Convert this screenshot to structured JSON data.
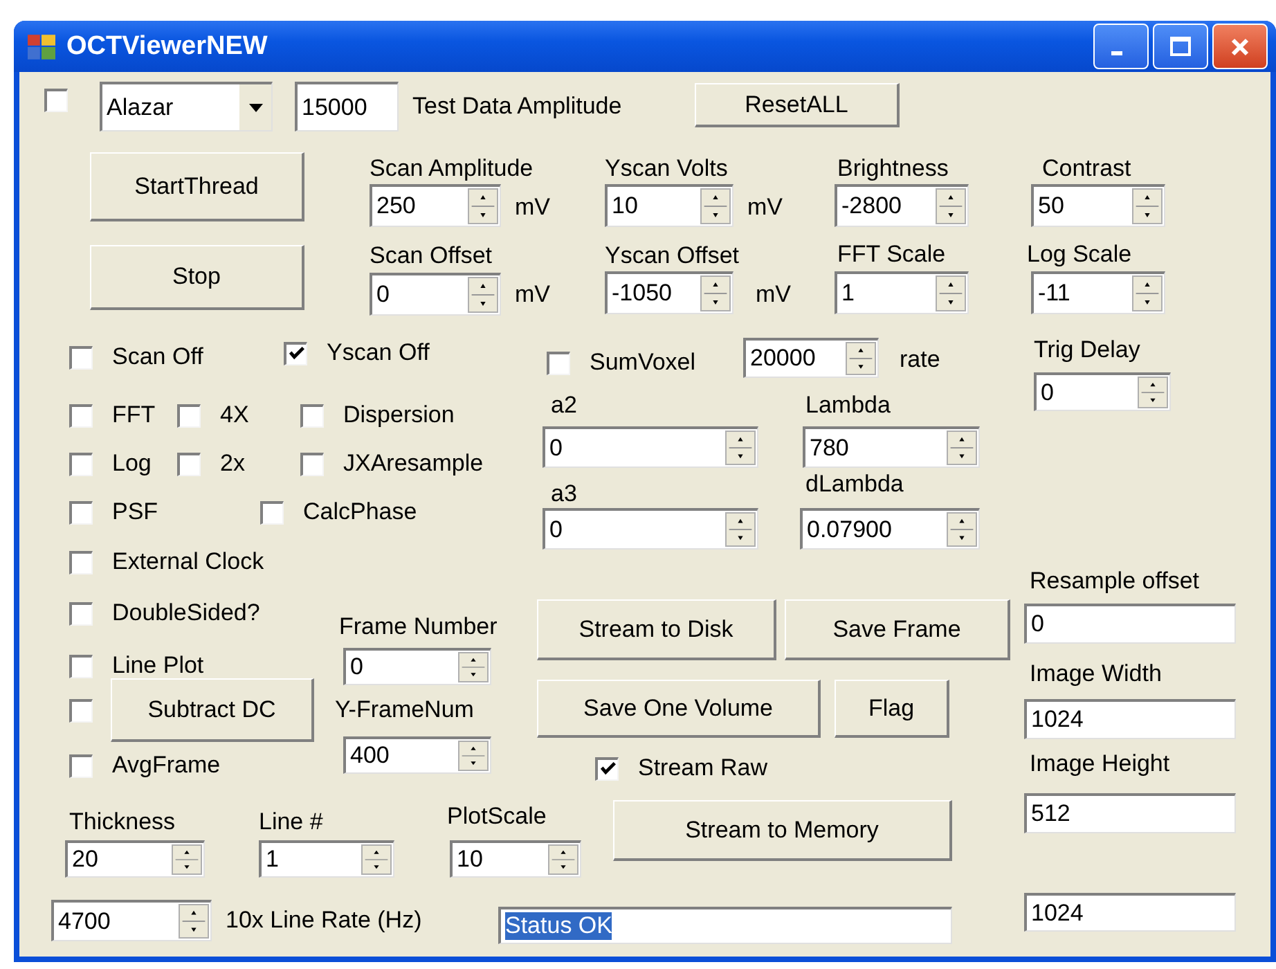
{
  "window": {
    "title": "OCTViewerNEW"
  },
  "controls": [
    {
      "kind": "checkbox",
      "checked": false
    },
    {
      "kind": "combo",
      "value": "Alazar"
    },
    {
      "kind": "textbox",
      "value": "15000"
    },
    {
      "kind": "label",
      "text": "Test Data Amplitude"
    },
    {
      "kind": "button",
      "label": "ResetALL"
    },
    {
      "kind": "button",
      "label": "StartThread"
    },
    {
      "kind": "button",
      "label": "Stop"
    },
    {
      "kind": "label",
      "text": "Scan Amplitude"
    },
    {
      "kind": "spin",
      "value": "250"
    },
    {
      "kind": "label",
      "text": "mV"
    },
    {
      "kind": "label",
      "text": "Yscan Volts"
    },
    {
      "kind": "spin",
      "value": "10"
    },
    {
      "kind": "label",
      "text": "mV"
    },
    {
      "kind": "label",
      "text": "Brightness"
    },
    {
      "kind": "spin",
      "value": "-2800"
    },
    {
      "kind": "label",
      "text": "Contrast"
    },
    {
      "kind": "spin",
      "value": "50"
    },
    {
      "kind": "label",
      "text": "Scan Offset"
    },
    {
      "kind": "spin",
      "value": "0"
    },
    {
      "kind": "label",
      "text": "mV"
    },
    {
      "kind": "label",
      "text": "Yscan Offset"
    },
    {
      "kind": "spin",
      "value": "-1050"
    },
    {
      "kind": "label",
      "text": "mV"
    },
    {
      "kind": "label",
      "text": "FFT Scale"
    },
    {
      "kind": "spin",
      "value": "1"
    },
    {
      "kind": "label",
      "text": "Log Scale"
    },
    {
      "kind": "spin",
      "value": "-11"
    },
    {
      "kind": "checkbox",
      "label": "Scan Off",
      "checked": false
    },
    {
      "kind": "checkbox",
      "label": "Yscan Off",
      "checked": true
    },
    {
      "kind": "checkbox",
      "label": "SumVoxel",
      "checked": false
    },
    {
      "kind": "spin",
      "value": "20000"
    },
    {
      "kind": "label",
      "text": "rate"
    },
    {
      "kind": "label",
      "text": "Trig Delay"
    },
    {
      "kind": "spin",
      "value": "0"
    },
    {
      "kind": "checkbox",
      "label": "FFT",
      "checked": false
    },
    {
      "kind": "checkbox",
      "label": "4X",
      "checked": false
    },
    {
      "kind": "checkbox",
      "label": "Dispersion",
      "checked": false
    },
    {
      "kind": "label",
      "text": "a2"
    },
    {
      "kind": "spin",
      "value": "0"
    },
    {
      "kind": "label",
      "text": "Lambda"
    },
    {
      "kind": "spin",
      "value": "780"
    },
    {
      "kind": "checkbox",
      "label": "Log",
      "checked": false
    },
    {
      "kind": "checkbox",
      "label": "2x",
      "checked": false
    },
    {
      "kind": "checkbox",
      "label": "JXAresample",
      "checked": false
    },
    {
      "kind": "label",
      "text": "a3"
    },
    {
      "kind": "spin",
      "value": "0"
    },
    {
      "kind": "label",
      "text": "dLambda"
    },
    {
      "kind": "spin",
      "value": "0.07900"
    },
    {
      "kind": "checkbox",
      "label": "PSF",
      "checked": false
    },
    {
      "kind": "checkbox",
      "label": "CalcPhase",
      "checked": false
    },
    {
      "kind": "checkbox",
      "label": "External Clock",
      "checked": false
    },
    {
      "kind": "checkbox",
      "label": "DoubleSided?",
      "checked": false
    },
    {
      "kind": "label",
      "text": "Frame Number"
    },
    {
      "kind": "button",
      "label": "Stream to Disk"
    },
    {
      "kind": "button",
      "label": "Save Frame"
    },
    {
      "kind": "label",
      "text": "Resample offset"
    },
    {
      "kind": "textbox",
      "value": "0"
    },
    {
      "kind": "checkbox",
      "label": "Line Plot",
      "checked": false
    },
    {
      "kind": "spin",
      "value": "0"
    },
    {
      "kind": "label",
      "text": "Image Width"
    },
    {
      "kind": "checkbox",
      "checked": false
    },
    {
      "kind": "button",
      "label": "Subtract DC"
    },
    {
      "kind": "label",
      "text": "Y-FrameNum"
    },
    {
      "kind": "button",
      "label": "Save One Volume"
    },
    {
      "kind": "button",
      "label": "Flag"
    },
    {
      "kind": "textbox",
      "value": "1024"
    },
    {
      "kind": "checkbox",
      "label": "AvgFrame",
      "checked": false
    },
    {
      "kind": "spin",
      "value": "400"
    },
    {
      "kind": "checkbox",
      "label": "Stream Raw",
      "checked": true
    },
    {
      "kind": "label",
      "text": "Image Height"
    },
    {
      "kind": "textbox",
      "value": "512"
    },
    {
      "kind": "label",
      "text": "Thickness"
    },
    {
      "kind": "label",
      "text": "Line #"
    },
    {
      "kind": "label",
      "text": "PlotScale"
    },
    {
      "kind": "button",
      "label": "Stream to Memory"
    },
    {
      "kind": "spin",
      "value": "20"
    },
    {
      "kind": "spin",
      "value": "1"
    },
    {
      "kind": "spin",
      "value": "10"
    },
    {
      "kind": "spin",
      "value": "4700"
    },
    {
      "kind": "label",
      "text": "10x Line Rate (Hz)"
    },
    {
      "kind": "textbox",
      "value": "Status OK",
      "text_selected": true
    },
    {
      "kind": "textbox",
      "value": "1024"
    }
  ]
}
